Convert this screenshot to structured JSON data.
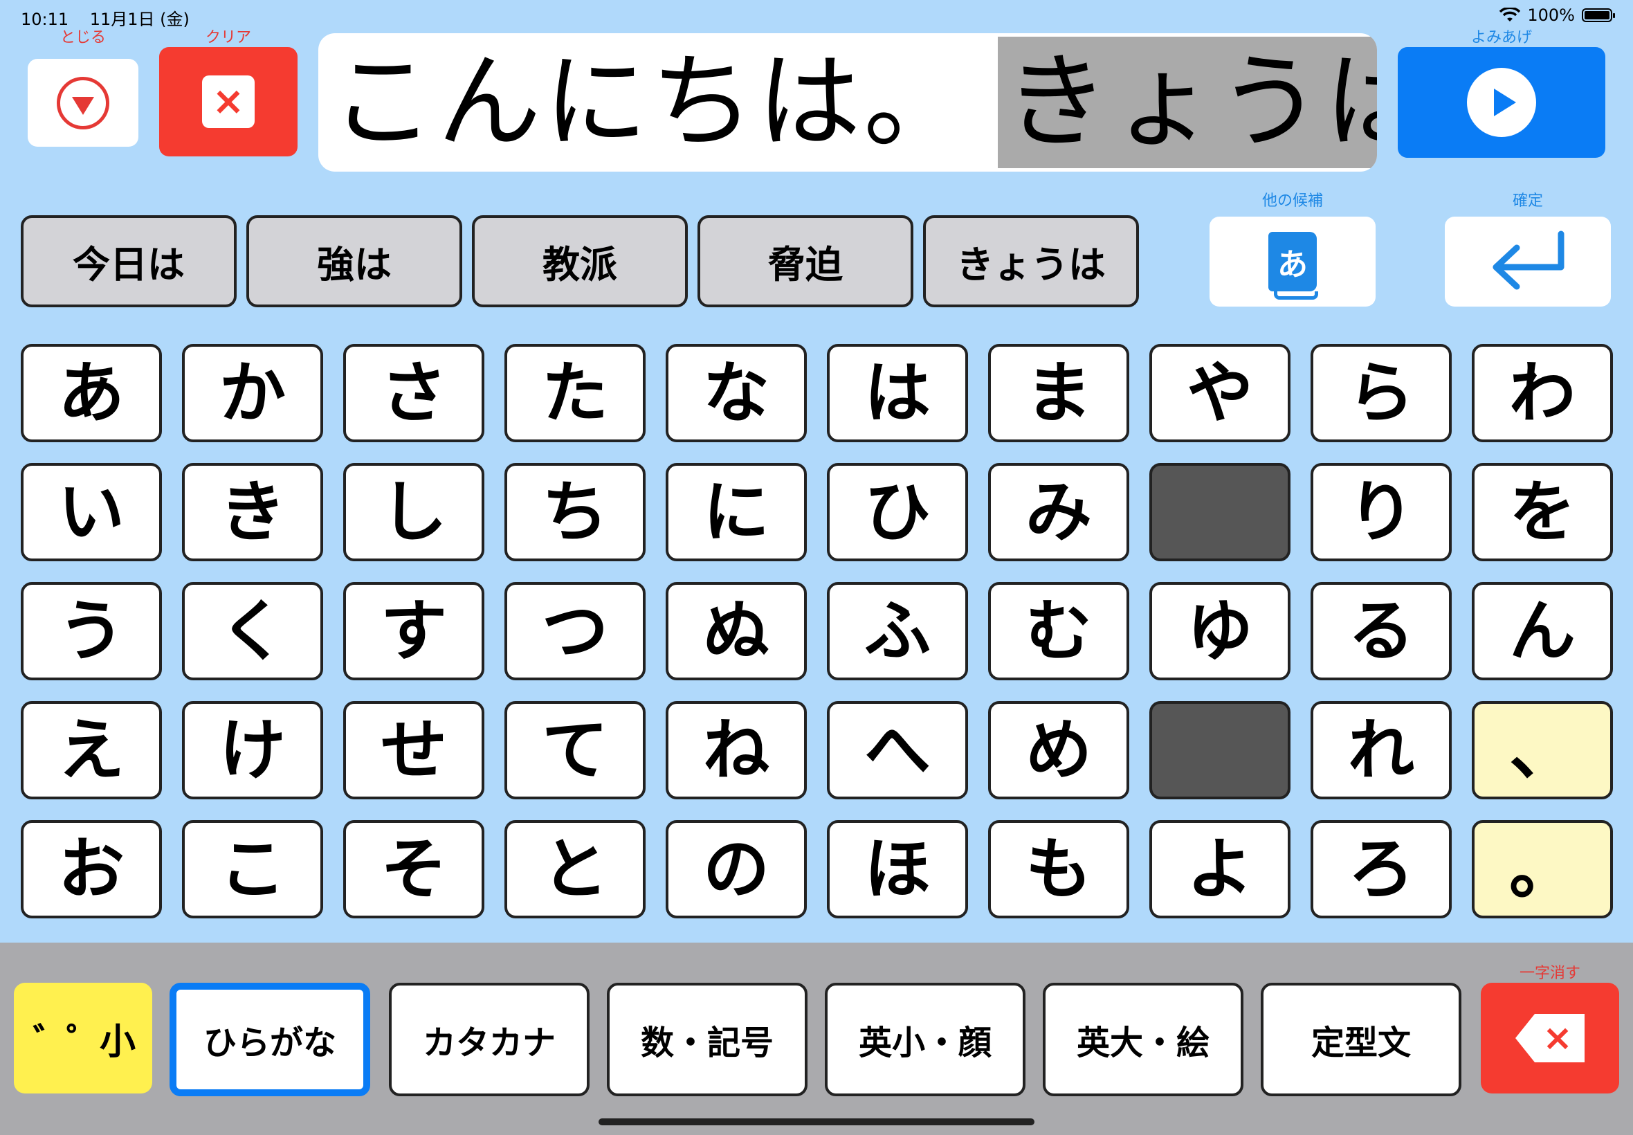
{
  "status_bar": {
    "time": "10:11",
    "date": "11月1日 (金)",
    "wifi": "wifi-icon",
    "battery_percent": "100%"
  },
  "top": {
    "close_label": "とじる",
    "clear_label": "クリア",
    "speak_label": "よみあげ",
    "committed_text": "こんにちは。",
    "composing_text": "きょうは"
  },
  "candidates": [
    "今日は",
    "強は",
    "教派",
    "脅迫",
    "きょうは"
  ],
  "side": {
    "other_candidates_label": "他の候補",
    "dict_glyph": "あ",
    "confirm_label": "確定"
  },
  "keyboard": {
    "rows": [
      [
        "あ",
        "か",
        "さ",
        "た",
        "な",
        "は",
        "ま",
        "や",
        "ら",
        "わ"
      ],
      [
        "い",
        "き",
        "し",
        "ち",
        "に",
        "ひ",
        "み",
        "",
        "り",
        "を"
      ],
      [
        "う",
        "く",
        "す",
        "つ",
        "ぬ",
        "ふ",
        "む",
        "ゆ",
        "る",
        "ん"
      ],
      [
        "え",
        "け",
        "せ",
        "て",
        "ね",
        "へ",
        "め",
        "",
        "れ",
        "、"
      ],
      [
        "お",
        "こ",
        "そ",
        "と",
        "の",
        "ほ",
        "も",
        "よ",
        "ろ",
        "。"
      ]
    ]
  },
  "bottom": {
    "dakuten_label": "゛゜小",
    "modes": [
      "ひらがな",
      "カタカナ",
      "数・記号",
      "英小・顔",
      "英大・絵",
      "定型文"
    ],
    "active_mode": "ひらがな",
    "delete_label": "一字消す"
  },
  "colors": {
    "background": "#b0d9fb",
    "accent_blue": "#0a7cf5",
    "danger_red": "#f53b30",
    "punct_yellow": "#fdf8c4"
  }
}
